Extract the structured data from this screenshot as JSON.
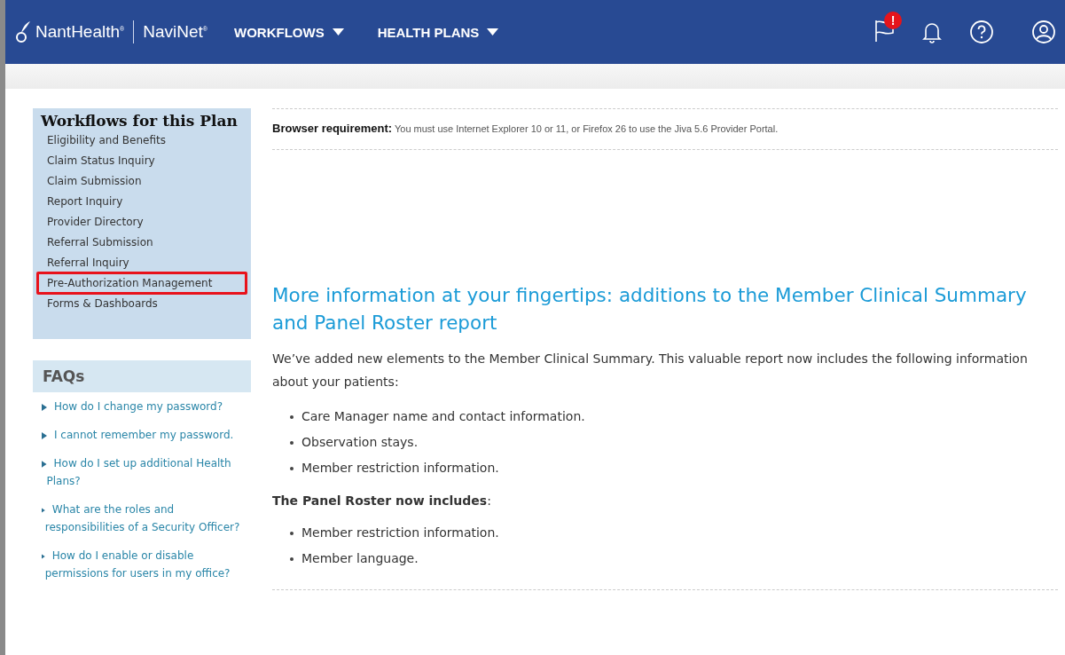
{
  "header": {
    "brand": "NantHealth$^{®}$",
    "product": "NaviNet$^{®}$",
    "menus": [
      {
        "label": "WORKFLOWS"
      },
      {
        "label": "HEALTH PLANS"
      }
    ],
    "alert_badge": "!"
  },
  "sidebar": {
    "title": "Workflows for this Plan",
    "items": [
      {
        "label": "Eligibility and Benefits",
        "highlighted": false
      },
      {
        "label": "Claim Status Inquiry",
        "highlighted": false
      },
      {
        "label": "Claim Submission",
        "highlighted": false
      },
      {
        "label": "Report Inquiry",
        "highlighted": false
      },
      {
        "label": "Provider Directory",
        "highlighted": false
      },
      {
        "label": "Referral Submission",
        "highlighted": false
      },
      {
        "label": "Referral Inquiry",
        "highlighted": false
      },
      {
        "label": "Pre-Authorization Management",
        "highlighted": true
      },
      {
        "label": "Forms & Dashboards",
        "highlighted": false
      }
    ]
  },
  "faqs": {
    "title": "FAQs",
    "items": [
      "How do I change my password?",
      "I cannot remember my password.",
      "How do I set up additional Health Plans?",
      "What are the roles and responsibilities of a Security Officer?",
      "How do I enable or disable permissions for users in my office?"
    ]
  },
  "main": {
    "notice": "**Browser requirement:** You must use Internet Explorer 10 or 11, or Firefox 26 to use the Jiva 5.6 Provider Portal.",
    "heading": "More information at your fingertips: additions to the Member Clinical Summary and Panel Roster report",
    "intro": "We’ve added new elements to the Member Clinical Summary. This valuable report now includes the following information about your patients:",
    "bullets_1": [
      "Care Manager name and contact information.",
      "Observation stays.",
      "Member restriction information."
    ],
    "subheading": "**The Panel Roster now includes**:",
    "bullets_2": [
      "Member restriction information.",
      "Member language."
    ]
  }
}
